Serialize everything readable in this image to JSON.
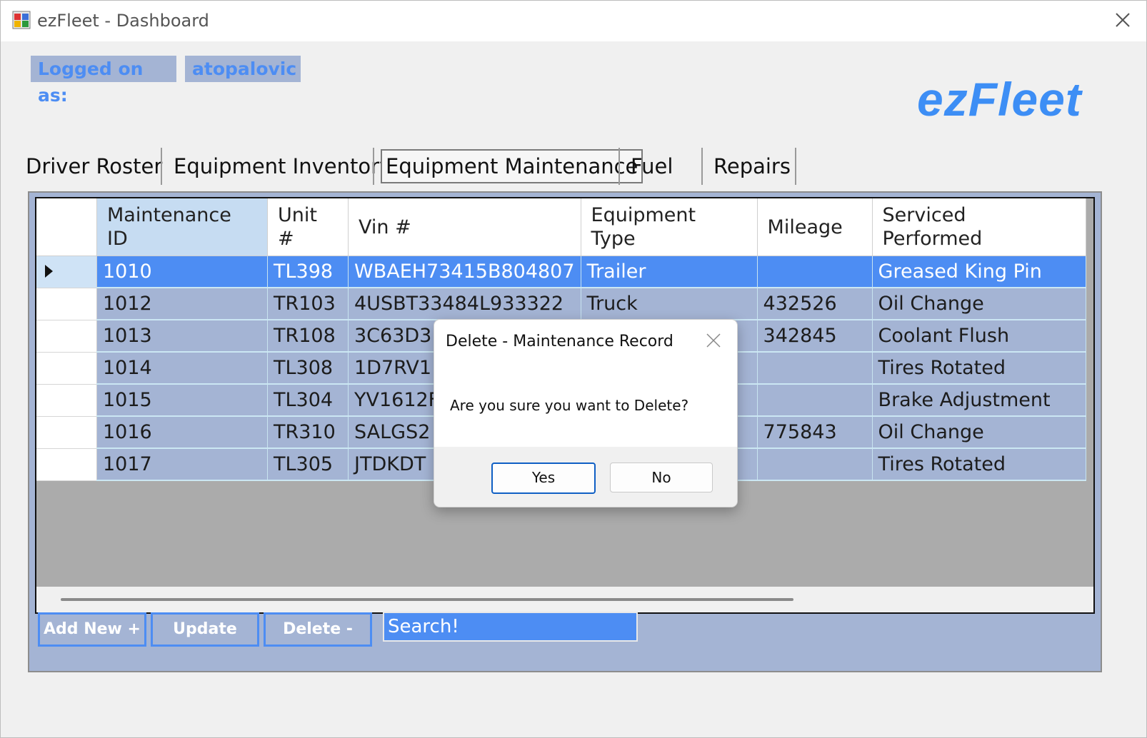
{
  "window": {
    "title": "ezFleet - Dashboard"
  },
  "header": {
    "logged_label": "Logged on as:",
    "username": "atopalovic",
    "brand": "ezFleet"
  },
  "tabs": [
    {
      "label": "Driver Roster"
    },
    {
      "label": "Equipment Inventory"
    },
    {
      "label": "Equipment Maintenance",
      "active": true
    },
    {
      "label": "Fuel"
    },
    {
      "label": "Repairs"
    }
  ],
  "grid": {
    "columns": [
      "Maintenance ID",
      "Unit #",
      "Vin #",
      "Equipment Type",
      "Mileage",
      "Serviced Performed"
    ],
    "column_lines": [
      [
        "Maintenance",
        "ID"
      ],
      [
        "Unit",
        "#"
      ],
      [
        "Vin #"
      ],
      [
        "Equipment",
        "Type"
      ],
      [
        "Mileage"
      ],
      [
        "Serviced",
        "Performed"
      ]
    ],
    "rows": [
      {
        "id": "1010",
        "unit": "TL398",
        "vin": "WBAEH73415B804807",
        "type": "Trailer",
        "mileage": "",
        "service": "Greased King Pin",
        "selected": true
      },
      {
        "id": "1012",
        "unit": "TR103",
        "vin": "4USBT33484L933322",
        "type": "Truck",
        "mileage": "432526",
        "service": "Oil Change"
      },
      {
        "id": "1013",
        "unit": "TR108",
        "vin": "3C63D3",
        "type": "",
        "mileage": "342845",
        "service": "Coolant Flush"
      },
      {
        "id": "1014",
        "unit": "TL308",
        "vin": "1D7RV1",
        "type": "",
        "mileage": "",
        "service": "Tires Rotated"
      },
      {
        "id": "1015",
        "unit": "TL304",
        "vin": "YV1612F",
        "type": "",
        "mileage": "",
        "service": "Brake Adjustment"
      },
      {
        "id": "1016",
        "unit": "TR310",
        "vin": "SALGS2",
        "type": "",
        "mileage": "775843",
        "service": "Oil Change"
      },
      {
        "id": "1017",
        "unit": "TL305",
        "vin": "JTDKDT",
        "type": "",
        "mileage": "",
        "service": "Tires Rotated"
      }
    ]
  },
  "actions": {
    "add_label": "Add New +",
    "update_label": "Update",
    "delete_label": "Delete -",
    "search_value": "Search!"
  },
  "dialog": {
    "title": "Delete - Maintenance Record",
    "message": "Are you sure you want to Delete?",
    "yes_label": "Yes",
    "no_label": "No"
  },
  "colors": {
    "accent": "#4d8df3",
    "panel": "#a4b4d4",
    "brand": "#3d8ef5"
  }
}
